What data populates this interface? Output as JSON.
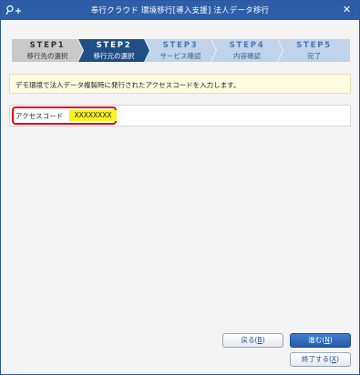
{
  "window": {
    "title": "奉行クラウド 環境移行[導入支援] 法人データ移行",
    "close_glyph": "✕",
    "app_icon": "key-plus-icon"
  },
  "steps": [
    {
      "step": "STEP1",
      "label": "移行先の選択",
      "state": "done"
    },
    {
      "step": "STEP2",
      "label": "移行元の選択",
      "state": "current"
    },
    {
      "step": "STEP3",
      "label": "サービス確認",
      "state": "upcoming"
    },
    {
      "step": "STEP4",
      "label": "内容確認",
      "state": "upcoming"
    },
    {
      "step": "STEP5",
      "label": "完了",
      "state": "upcoming"
    }
  ],
  "info_message": "デモ環境で法人データ複製時に発行されたアクセスコードを入力します。",
  "access_code": {
    "label": "アクセスコード",
    "value": "XXXXXXXX"
  },
  "buttons": {
    "back": {
      "label": "戻る(",
      "key": "B",
      "suffix": ")"
    },
    "next": {
      "label": "進む(",
      "key": "N",
      "suffix": ")"
    },
    "finish": {
      "label": "終了する(",
      "key": "X",
      "suffix": ")"
    }
  },
  "colors": {
    "titlebar": "#2d5fa8",
    "step_done": "#c9c9c9",
    "step_current": "#1f4f86",
    "step_upcoming": "#bfd4ea",
    "highlight_border": "#e60012",
    "value_highlight": "#f7f41f",
    "primary_button": "#265da9"
  }
}
